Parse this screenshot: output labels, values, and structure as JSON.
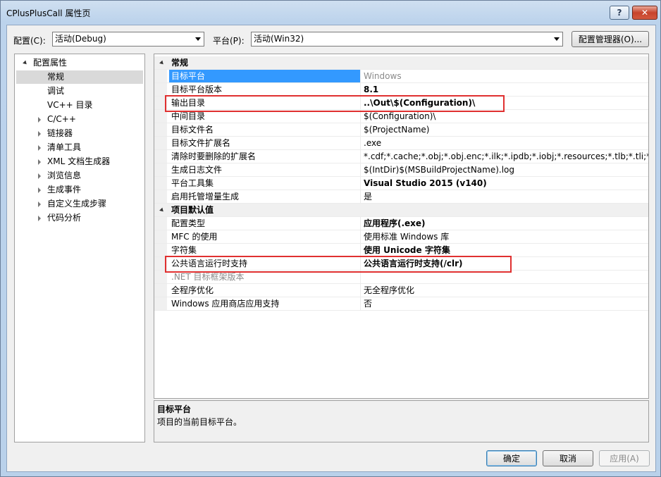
{
  "window": {
    "title": "CPlusPlusCall 属性页",
    "help": "?",
    "close": "✕"
  },
  "toolbar": {
    "config_label": "配置(C):",
    "config_value": "活动(Debug)",
    "platform_label": "平台(P):",
    "platform_value": "活动(Win32)",
    "manager_button": "配置管理器(O)..."
  },
  "tree": {
    "root": "配置属性",
    "items": [
      "常规",
      "调试",
      "VC++ 目录",
      "C/C++",
      "链接器",
      "清单工具",
      "XML 文档生成器",
      "浏览信息",
      "生成事件",
      "自定义生成步骤",
      "代码分析"
    ],
    "selected": "常规"
  },
  "grid": {
    "categories": [
      "常规",
      "项目默认值"
    ],
    "general": [
      {
        "name": "目标平台",
        "value": "Windows"
      },
      {
        "name": "目标平台版本",
        "value": "8.1"
      },
      {
        "name": "输出目录",
        "value": "..\\Out\\$(Configuration)\\"
      },
      {
        "name": "中间目录",
        "value": "$(Configuration)\\"
      },
      {
        "name": "目标文件名",
        "value": "$(ProjectName)"
      },
      {
        "name": "目标文件扩展名",
        "value": ".exe"
      },
      {
        "name": "清除时要删除的扩展名",
        "value": "*.cdf;*.cache;*.obj;*.obj.enc;*.ilk;*.ipdb;*.iobj;*.resources;*.tlb;*.tli;*.tlh;*.tmp"
      },
      {
        "name": "生成日志文件",
        "value": "$(IntDir)$(MSBuildProjectName).log"
      },
      {
        "name": "平台工具集",
        "value": "Visual Studio 2015 (v140)"
      },
      {
        "name": "启用托管增量生成",
        "value": "是"
      }
    ],
    "defaults": [
      {
        "name": "配置类型",
        "value": "应用程序(.exe)"
      },
      {
        "name": "MFC 的使用",
        "value": "使用标准 Windows 库"
      },
      {
        "name": "字符集",
        "value": "使用 Unicode 字符集"
      },
      {
        "name": "公共语言运行时支持",
        "value": "公共语言运行时支持(/clr)"
      },
      {
        "name": ".NET 目标框架版本",
        "value": ""
      },
      {
        "name": "全程序优化",
        "value": "无全程序优化"
      },
      {
        "name": "Windows 应用商店应用支持",
        "value": "否"
      }
    ]
  },
  "description": {
    "title": "目标平台",
    "text": "项目的当前目标平台。"
  },
  "buttons": {
    "ok": "确定",
    "cancel": "取消",
    "apply": "应用(A)"
  },
  "colors": {
    "selection": "#3399ff",
    "highlight_box": "#e03030"
  }
}
